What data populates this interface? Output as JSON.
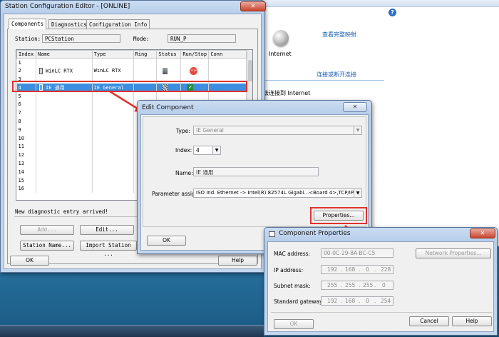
{
  "network_window": {
    "link_full_map": "查看完整映射",
    "internet_label": "Internet",
    "link_connect_disconnect": "连接或断开连接",
    "partial_text": "法连接到 Internet"
  },
  "station_editor": {
    "title": "Station Configuration Editor - [ONLINE]",
    "close_label": "✕",
    "tabs": [
      "Components",
      "Diagnostics",
      "Configuration Info"
    ],
    "station_label": "Station:",
    "station_value": "PCStation",
    "mode_label": "Mode:",
    "mode_value": "RUN_P",
    "columns": [
      "Index",
      "Name",
      "Type",
      "Ring",
      "Status",
      "Run/Stop",
      "Conn"
    ],
    "rows": [
      {
        "index": "1",
        "name": "",
        "type": ""
      },
      {
        "index": "2",
        "name": "WinLC RTX",
        "type": "WinLC RTX"
      },
      {
        "index": "3",
        "name": "",
        "type": ""
      },
      {
        "index": "4",
        "name": "IE 通用",
        "type": "IE General"
      },
      {
        "index": "5",
        "name": "",
        "type": ""
      },
      {
        "index": "6",
        "name": "",
        "type": ""
      },
      {
        "index": "7",
        "name": "",
        "type": ""
      },
      {
        "index": "8",
        "name": "",
        "type": ""
      },
      {
        "index": "9",
        "name": "",
        "type": ""
      },
      {
        "index": "10",
        "name": "",
        "type": ""
      },
      {
        "index": "11",
        "name": "",
        "type": ""
      },
      {
        "index": "12",
        "name": "",
        "type": ""
      },
      {
        "index": "13",
        "name": "",
        "type": ""
      },
      {
        "index": "14",
        "name": "",
        "type": ""
      },
      {
        "index": "15",
        "name": "",
        "type": ""
      },
      {
        "index": "16",
        "name": "",
        "type": ""
      }
    ],
    "stop_badge": "STOP",
    "status_message": "New diagnostic entry arrived!",
    "btn_add": "Add...",
    "btn_edit": "Edit...",
    "btn_station_name": "Station Name...",
    "btn_import_station": "Import Station ...",
    "btn_ok": "OK",
    "btn_help": "Help"
  },
  "edit_component": {
    "title": "Edit Component",
    "close_label": "✕",
    "type_label": "Type:",
    "type_value": "IE General",
    "index_label": "Index:",
    "index_value": "4",
    "name_label": "Name:",
    "name_value": "IE 通用",
    "param_label": "Parameter assig.:",
    "param_value": "ISO Ind. Ethernet -> Intel(R) 82574L Gigabi...<Board 4>,TCP/IP -> I",
    "btn_properties": "Properties...",
    "btn_ok": "OK"
  },
  "component_properties": {
    "title": "Component Properties",
    "close_label": "✕",
    "mac_label": "MAC address:",
    "mac_value": "00-0C-29-8A-BC-C5",
    "ip_label": "IP address:",
    "ip_octets": [
      "192",
      "168",
      "0",
      "228"
    ],
    "subnet_label": "Subnet mask:",
    "subnet_octets": [
      "255",
      "255",
      "255",
      "0"
    ],
    "gateway_label": "Standard gateway:",
    "gateway_octets": [
      "192",
      "168",
      "0",
      "254"
    ],
    "btn_network_properties": "Network Properties...",
    "btn_ok": "OK",
    "btn_cancel": "Cancel",
    "btn_help": "Help"
  },
  "colors": {
    "selection": "#3d8ee0",
    "highlight_red": "#e0322d",
    "link_blue": "#1a5fb4"
  }
}
